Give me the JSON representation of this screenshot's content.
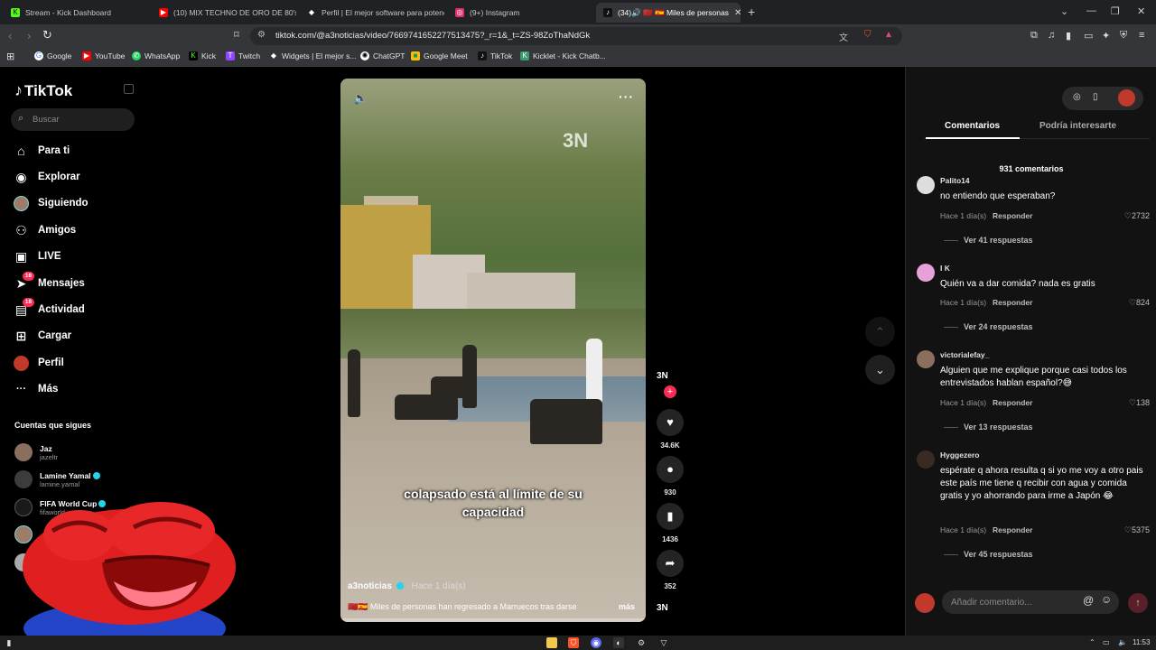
{
  "browser": {
    "tabs": [
      {
        "title": "Stream - Kick Dashboard",
        "color": "#53fc18",
        "glyph": "K"
      },
      {
        "title": "(10) MIX TECHNO DE ORO DE 80's &",
        "color": "#ff0000",
        "glyph": "▶"
      },
      {
        "title": "Perfil | El mejor software para potenc",
        "color": "#ffffff",
        "glyph": "◆"
      },
      {
        "title": "(9+) Instagram",
        "color": "#e1306c",
        "glyph": "◎"
      },
      {
        "title": "(34)🔊 🇲🇦 🇪🇸 Miles de personas",
        "color": "#111111",
        "glyph": "♪"
      }
    ],
    "url": "tiktok.com/@a3noticias/video/7669741652277513475?_r=1&_t=ZS-98ZoThaNdGk",
    "bookmarks": [
      {
        "label": "Google",
        "color": "#4285f4",
        "glyph": "G"
      },
      {
        "label": "YouTube",
        "color": "#ff0000",
        "glyph": "▶"
      },
      {
        "label": "WhatsApp",
        "color": "#25d366",
        "glyph": "✆"
      },
      {
        "label": "Kick",
        "color": "#53fc18",
        "glyph": "K"
      },
      {
        "label": "Twitch",
        "color": "#9146ff",
        "glyph": "T"
      },
      {
        "label": "Widgets | El mejor s...",
        "color": "#ffffff",
        "glyph": "◆"
      },
      {
        "label": "ChatGPT",
        "color": "#ffffff",
        "glyph": "✺"
      },
      {
        "label": "Google Meet",
        "color": "#fbbc04",
        "glyph": "■"
      },
      {
        "label": "TikTok",
        "color": "#111111",
        "glyph": "♪"
      },
      {
        "label": "Kicklet - Kick Chatb...",
        "color": "#3d9970",
        "glyph": "K"
      }
    ]
  },
  "sidebar": {
    "logo": "TikTok",
    "search_placeholder": "Buscar",
    "items": [
      {
        "label": "Para ti",
        "icon": "home-icon",
        "glyph": "⌂"
      },
      {
        "label": "Explorar",
        "icon": "compass-icon",
        "glyph": "⊘"
      },
      {
        "label": "Siguiendo",
        "icon": "avatar-icon",
        "glyph": ""
      },
      {
        "label": "Amigos",
        "icon": "friends-icon",
        "glyph": "⚇"
      },
      {
        "label": "LIVE",
        "icon": "live-icon",
        "glyph": "▣"
      },
      {
        "label": "Mensajes",
        "icon": "messages-icon",
        "glyph": "➤",
        "badge": "16"
      },
      {
        "label": "Actividad",
        "icon": "activity-icon",
        "glyph": "▤",
        "badge": "18"
      },
      {
        "label": "Cargar",
        "icon": "upload-icon",
        "glyph": "⊞"
      },
      {
        "label": "Perfil",
        "icon": "profile-icon",
        "glyph": ""
      },
      {
        "label": "Más",
        "icon": "more-icon",
        "glyph": "···"
      }
    ],
    "following_title": "Cuentas que sigues",
    "following": [
      {
        "name": "Jaz",
        "handle": "jazeltr"
      },
      {
        "name": "Lamine Yamal",
        "handle": "lamine.yamal"
      },
      {
        "name": "FIFA World Cup",
        "handle": "fifaworld"
      }
    ]
  },
  "video": {
    "watermark": "3N",
    "caption": "colapsado está al límite de su capacidad",
    "author": "a3noticias",
    "ago": "· Hace 1 día(s)",
    "description": "🇲🇦🇪🇸 Miles de personas han regresado a Marruecos tras darse",
    "more": "más",
    "progress": 0.0
  },
  "actions": {
    "channel": "3N",
    "likes": "34.6K",
    "comments": "930",
    "saves": "1436",
    "shares": "352"
  },
  "comments_panel": {
    "tab_comments": "Comentarios",
    "tab_interest": "Podría interesarte",
    "count": "931 comentarios",
    "reply_label": "Responder",
    "items": [
      {
        "user": "Palito14",
        "text": "no entiendo que esperaban?",
        "time": "Hace 1 día(s)",
        "likes": "2732",
        "replies": "Ver 41 respuestas"
      },
      {
        "user": "I K",
        "text": "Quién va a dar comida? nada es gratis",
        "time": "Hace 1 día(s)",
        "likes": "824",
        "replies": "Ver 24 respuestas"
      },
      {
        "user": "victorialefay_",
        "text": "Alguien que me explique porque casi todos los entrevistados hablan español?😅",
        "time": "Hace 1 día(s)",
        "likes": "138",
        "replies": "Ver 13 respuestas"
      },
      {
        "user": "Hyggezero",
        "text": "espérate q ahora resulta q si yo me voy a otro pais este país me tiene q recibir con agua y comida gratis y yo ahorrando para irme a Japón 😂",
        "time": "Hace 1 día(s)",
        "likes": "5375",
        "replies": "Ver 45 respuestas"
      }
    ],
    "input_placeholder": "Añadir comentario..."
  },
  "taskbar": {
    "time": "11:53"
  }
}
